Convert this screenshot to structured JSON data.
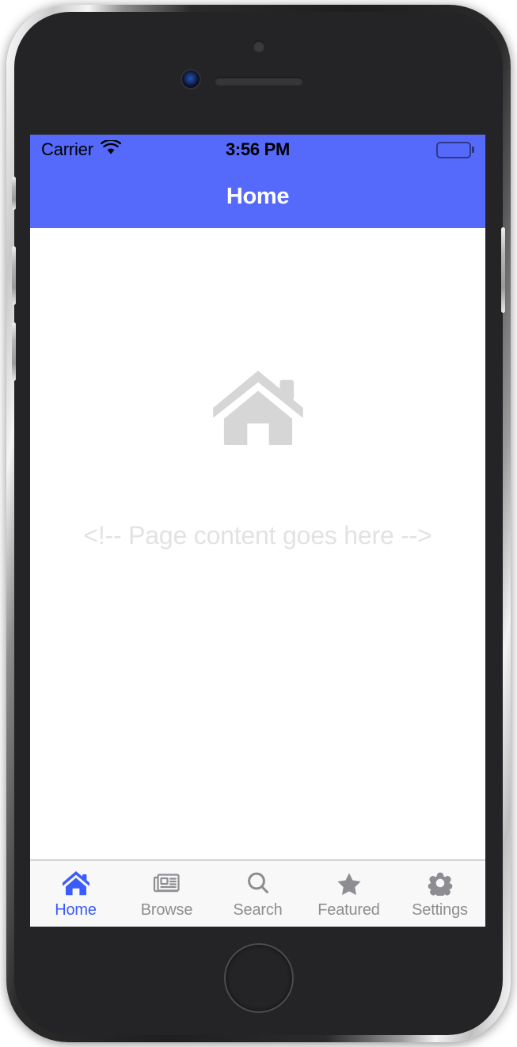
{
  "device": {
    "name": "iphone-device-frame",
    "hardware": {
      "sensor": "proximity-sensor",
      "camera": "front-camera",
      "earpiece": "earpiece-speaker",
      "home_button": "home-button",
      "buttons": [
        "silent-switch",
        "volume-up-button",
        "volume-down-button",
        "power-button"
      ]
    }
  },
  "status_bar": {
    "carrier": "Carrier",
    "wifi_icon": "wifi-icon",
    "time": "3:56 PM",
    "battery_icon": "battery-full-icon",
    "background_color": "#5569fa"
  },
  "nav_bar": {
    "title": "Home",
    "background_color": "#5569fa",
    "title_color": "#ffffff"
  },
  "content": {
    "watermark_icon": "house-icon",
    "watermark_color": "#d6d6d6",
    "placeholder_text": "<!-- Page content goes here -->",
    "placeholder_color": "#e2e2e2"
  },
  "tab_bar": {
    "background_color": "#f8f8f8",
    "active_color": "#3b5bfc",
    "inactive_color": "#8e8e92",
    "items": [
      {
        "label": "Home",
        "icon": "house-icon",
        "active": true
      },
      {
        "label": "Browse",
        "icon": "newspaper-icon",
        "active": false
      },
      {
        "label": "Search",
        "icon": "magnifier-icon",
        "active": false
      },
      {
        "label": "Featured",
        "icon": "star-icon",
        "active": false
      },
      {
        "label": "Settings",
        "icon": "gear-icon",
        "active": false
      }
    ]
  }
}
